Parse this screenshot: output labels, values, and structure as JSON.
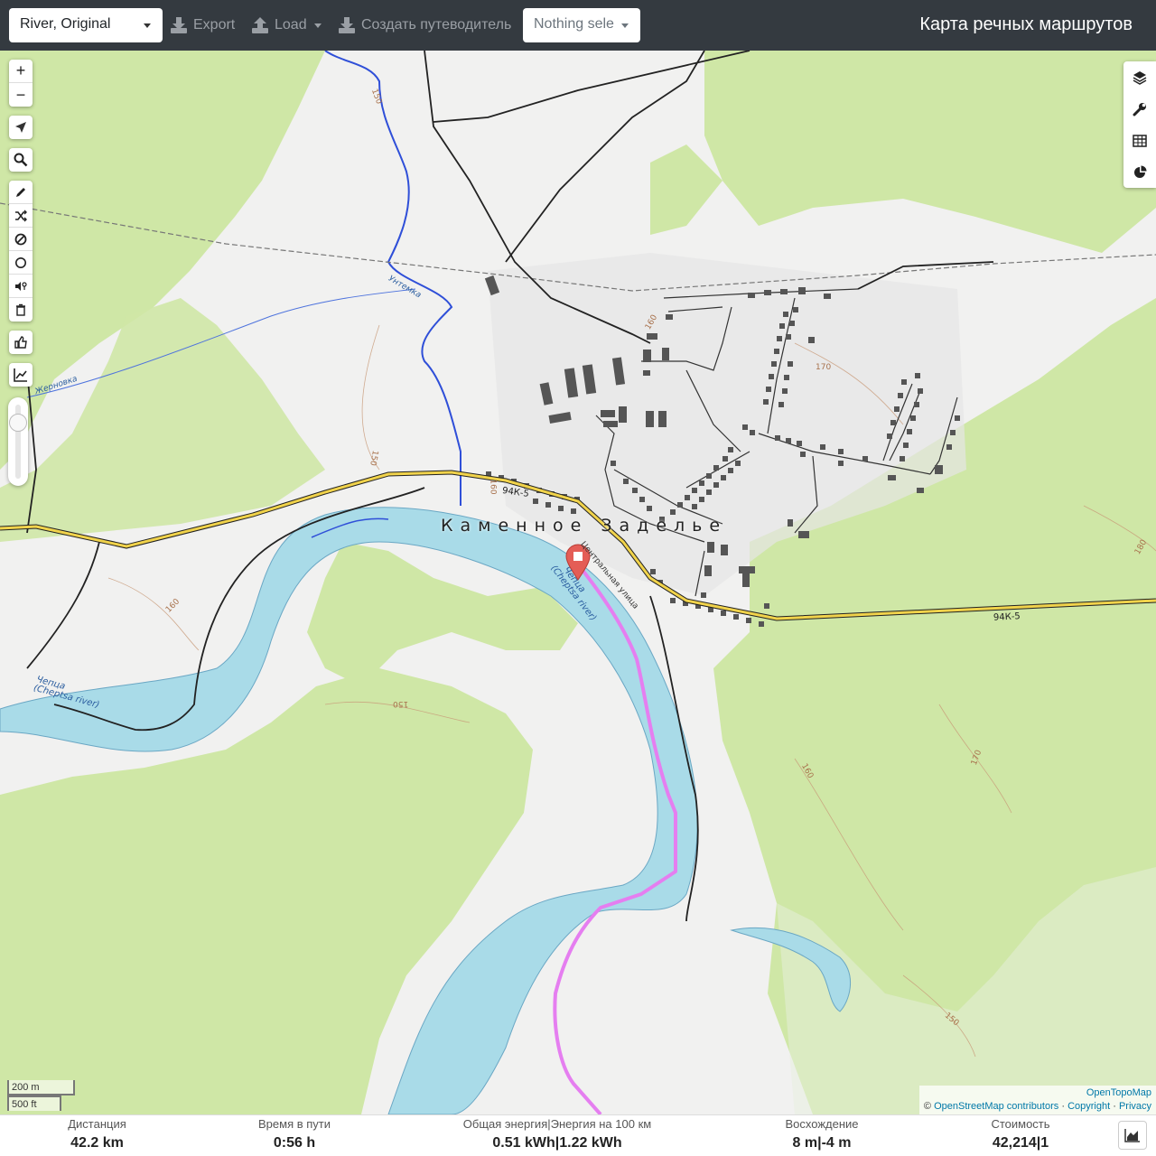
{
  "navbar": {
    "profile": "River, Original",
    "export_label": "Export",
    "load_label": "Load",
    "guide_label": "Создать путеводитель",
    "select_placeholder": "Nothing sele",
    "brand": "Карта речных маршрутов"
  },
  "map": {
    "place_name": "Каменное Заделье",
    "road_label_1": "94К-5",
    "road_label_2": "94К-5",
    "street_label": "Центральная улица",
    "river_main_ru": "Чепца",
    "river_main_en": "(Cheptsa river)",
    "river_west_ru": "Чепца",
    "river_west_en": "(Cheptsa river)",
    "stream_untemka": "Унтемка",
    "stream_zhernovka": "Жерновка",
    "contours": [
      "170",
      "160",
      "150",
      "160",
      "150",
      "160",
      "170",
      "180",
      "150",
      "160",
      "150"
    ],
    "colors": {
      "forest": "#cfe7a6",
      "river": "#a9dbe8",
      "route": "#e57ef0",
      "road": "#f1d34b",
      "marker": "#e45d56"
    }
  },
  "controls": {
    "zoom_in": "+",
    "zoom_out": "−",
    "left_icons": [
      "locate-icon",
      "search-icon",
      "pencil-icon",
      "shuffle-icon",
      "no-entry-icon",
      "circle-icon",
      "pin-mute-icon",
      "trash-icon",
      "thumbs-up-icon",
      "chart-line-icon"
    ],
    "right_icons": [
      "layers-icon",
      "wrench-icon",
      "table-icon",
      "pie-chart-icon"
    ]
  },
  "scale": {
    "metric": "200 m",
    "imperial": "500 ft"
  },
  "attribution": {
    "provider": "OpenTopoMap",
    "copyright_symbol": "©",
    "osm": "OpenStreetMap contributors",
    "sep1": "·",
    "copyright": "Copyright",
    "sep2": "·",
    "privacy": "Privacy"
  },
  "stats": {
    "distance": {
      "title": "Дистанция",
      "value": "42.2",
      "unit": "km"
    },
    "time": {
      "title": "Время в пути",
      "value": "0:56",
      "unit": "h"
    },
    "energy": {
      "title": "Общая энергия|Энергия на 100 км",
      "value": "0.51 kWh|1.22 kWh"
    },
    "ascent": {
      "title": "Восхождение",
      "value": "8 m|-4 m"
    },
    "cost": {
      "title": "Стоимость",
      "value": "42,214|1"
    }
  }
}
